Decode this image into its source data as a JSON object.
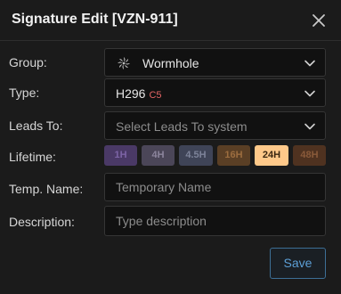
{
  "dialog": {
    "title": "Signature Edit [VZN-911]"
  },
  "form": {
    "group": {
      "label": "Group:",
      "value": "Wormhole",
      "icon": "wormhole-icon"
    },
    "type": {
      "label": "Type:",
      "value": "H296",
      "class_tag": "C5",
      "class_color": "#e46565"
    },
    "leads_to": {
      "label": "Leads To:",
      "placeholder": "Select Leads To system"
    },
    "lifetime": {
      "label": "Lifetime:",
      "selected": "24H",
      "options": [
        {
          "label": "1H",
          "bg": "#4a3966",
          "fg": "#7d64a6"
        },
        {
          "label": "4H",
          "bg": "#4b4658",
          "fg": "#8c859d"
        },
        {
          "label": "4.5H",
          "bg": "#3f4457",
          "fg": "#7d8399"
        },
        {
          "label": "16H",
          "bg": "#5a3f25",
          "fg": "#9c6d3f"
        },
        {
          "label": "24H",
          "bg": "#ffc98a",
          "fg": "#3a2610"
        },
        {
          "label": "48H",
          "bg": "#4f3220",
          "fg": "#8a5a3a"
        }
      ]
    },
    "temp_name": {
      "label": "Temp. Name:",
      "placeholder": "Temporary Name"
    },
    "description": {
      "label": "Description:",
      "placeholder": "Type description"
    }
  },
  "actions": {
    "save_label": "Save"
  }
}
